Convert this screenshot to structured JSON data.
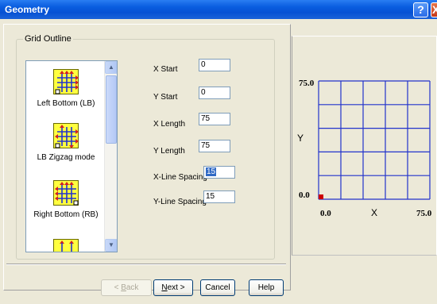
{
  "window": {
    "title": "Geometry"
  },
  "titlebar": {
    "help_glyph": "?",
    "close_glyph": "X"
  },
  "group": {
    "legend": "Grid Outline"
  },
  "modes": [
    {
      "label": "Left Bottom (LB)",
      "icon": "grid-left-bottom-icon"
    },
    {
      "label": "LB Zigzag mode",
      "icon": "grid-zigzag-icon"
    },
    {
      "label": "Right Bottom (RB)",
      "icon": "grid-right-bottom-icon"
    }
  ],
  "scrollbar": {
    "up_glyph": "▲",
    "down_glyph": "▼"
  },
  "fields": {
    "x_start": {
      "label": "X Start",
      "value": "0"
    },
    "y_start": {
      "label": "Y Start",
      "value": "0"
    },
    "x_length": {
      "label": "X Length",
      "value": "75"
    },
    "y_length": {
      "label": "Y Length",
      "value": "75"
    },
    "x_spacing": {
      "label": "X-Line Spacing",
      "value": "15"
    },
    "y_spacing": {
      "label": "Y-Line Spacing",
      "value": "15"
    }
  },
  "preview": {
    "y_max_label": "75.0",
    "y_min_label": "0.0",
    "x_min_label": "0.0",
    "x_max_label": "75.0",
    "x_axis_label": "X",
    "y_axis_label": "Y",
    "grid_color": "#2233cc",
    "origin_color": "#cc0000"
  },
  "buttons": {
    "back": {
      "prefix": "< ",
      "accel": "B",
      "rest": "ack"
    },
    "next": {
      "accel": "N",
      "rest": "ext >"
    },
    "cancel": "Cancel",
    "help": "Help"
  }
}
